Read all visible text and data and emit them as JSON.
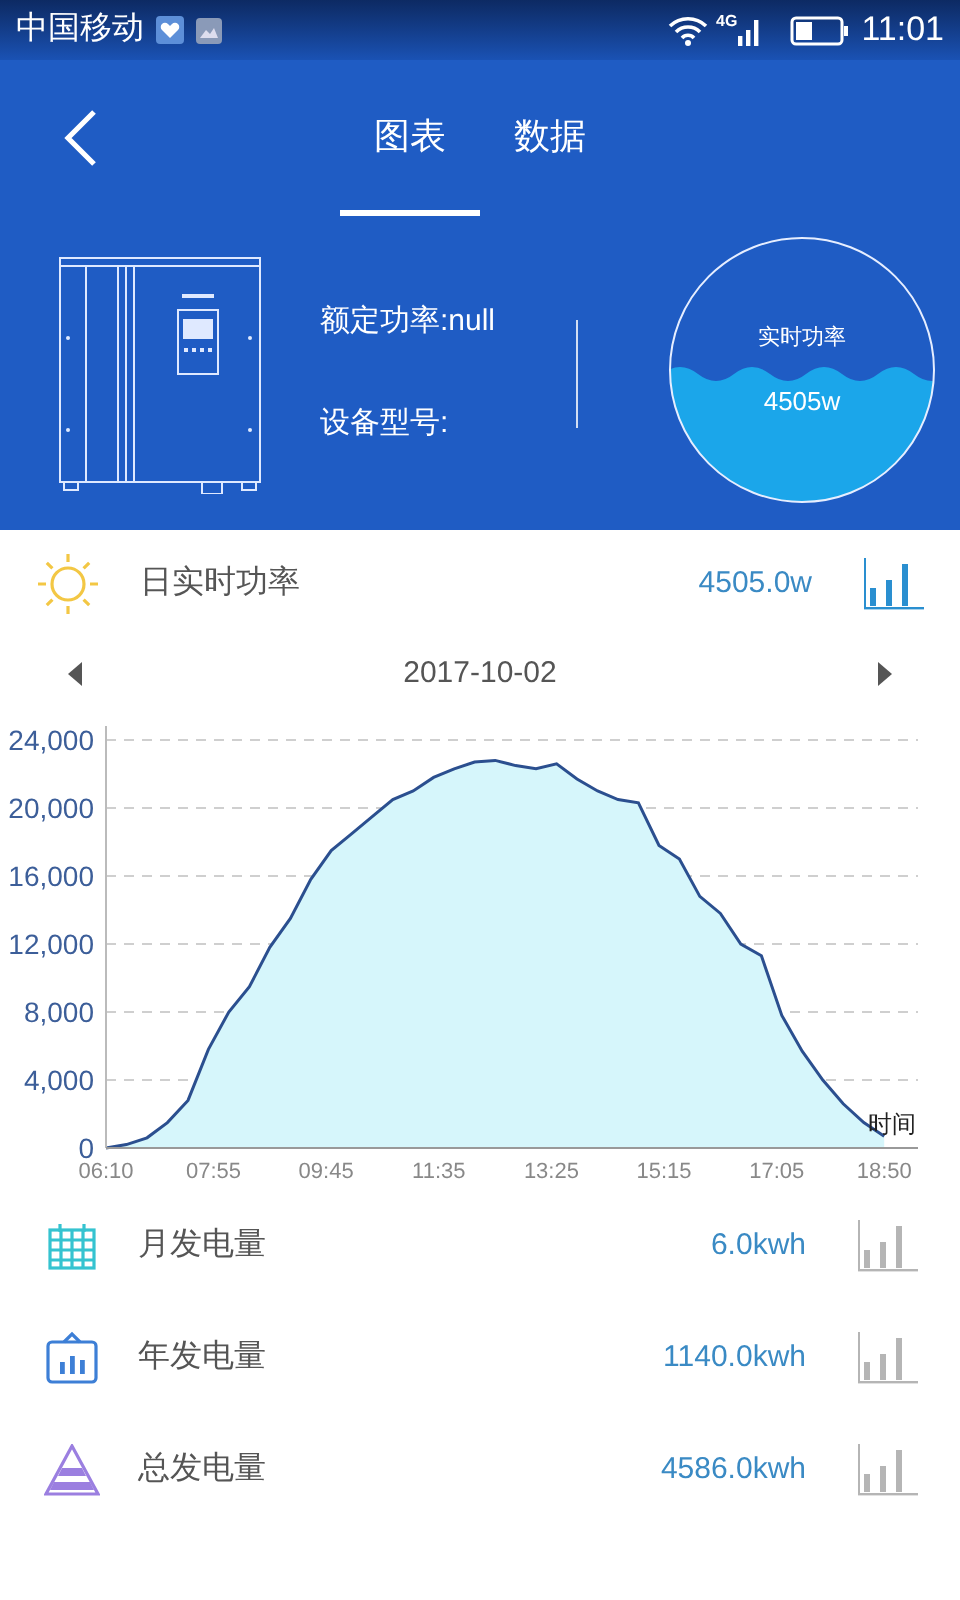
{
  "status_bar": {
    "carrier": "中国移动",
    "network": "4G",
    "time": "11:01"
  },
  "nav": {
    "tabs": [
      {
        "label": "图表",
        "selected": true
      },
      {
        "label": "数据",
        "selected": false
      }
    ]
  },
  "device": {
    "rated_power": "额定功率:null",
    "model": "设备型号:",
    "gauge": {
      "label": "实时功率",
      "value": "4505w"
    }
  },
  "realtime": {
    "label": "日实时功率",
    "value": "4505.0w",
    "selected": true
  },
  "date": "2017-10-02",
  "chart": {
    "chart_data": {
      "type": "area",
      "grid": true,
      "xlabel": "时间",
      "xlim": [
        370,
        1163
      ],
      "ylim": [
        0,
        24000
      ],
      "xticks": [
        {
          "value": 370,
          "label": "06:10"
        },
        {
          "value": 475,
          "label": "07:55"
        },
        {
          "value": 585,
          "label": "09:45"
        },
        {
          "value": 695,
          "label": "11:35"
        },
        {
          "value": 805,
          "label": "13:25"
        },
        {
          "value": 915,
          "label": "15:15"
        },
        {
          "value": 1025,
          "label": "17:05"
        },
        {
          "value": 1130,
          "label": "18:50"
        }
      ],
      "yticks": [
        {
          "value": 0,
          "label": "0"
        },
        {
          "value": 4000,
          "label": "4,000"
        },
        {
          "value": 8000,
          "label": "8,000"
        },
        {
          "value": 12000,
          "label": "12,000"
        },
        {
          "value": 16000,
          "label": "16,000"
        },
        {
          "value": 20000,
          "label": "20,000"
        },
        {
          "value": 24000,
          "label": "24,000"
        }
      ],
      "x": [
        370,
        390,
        410,
        430,
        450,
        470,
        490,
        510,
        530,
        550,
        570,
        590,
        610,
        630,
        650,
        670,
        690,
        710,
        730,
        750,
        770,
        790,
        810,
        830,
        850,
        870,
        890,
        910,
        930,
        950,
        970,
        990,
        1010,
        1030,
        1050,
        1070,
        1090,
        1110,
        1130
      ],
      "series": [
        {
          "color": "#2b4f8f",
          "values": [
            0,
            200,
            600,
            1500,
            2800,
            5800,
            8000,
            9500,
            11800,
            13500,
            15800,
            17500,
            18500,
            19500,
            20500,
            21000,
            21800,
            22300,
            22700,
            22800,
            22500,
            22300,
            22600,
            21700,
            21000,
            20500,
            20300,
            17800,
            17000,
            14800,
            13800,
            12000,
            11300,
            7800,
            5700,
            4000,
            2600,
            1500,
            700
          ]
        }
      ]
    }
  },
  "totals": [
    {
      "label": "月发电量",
      "value": "6.0kwh",
      "selected": false
    },
    {
      "label": "年发电量",
      "value": "1140.0kwh",
      "selected": false
    },
    {
      "label": "总发电量",
      "value": "4586.0kwh",
      "selected": false
    }
  ]
}
